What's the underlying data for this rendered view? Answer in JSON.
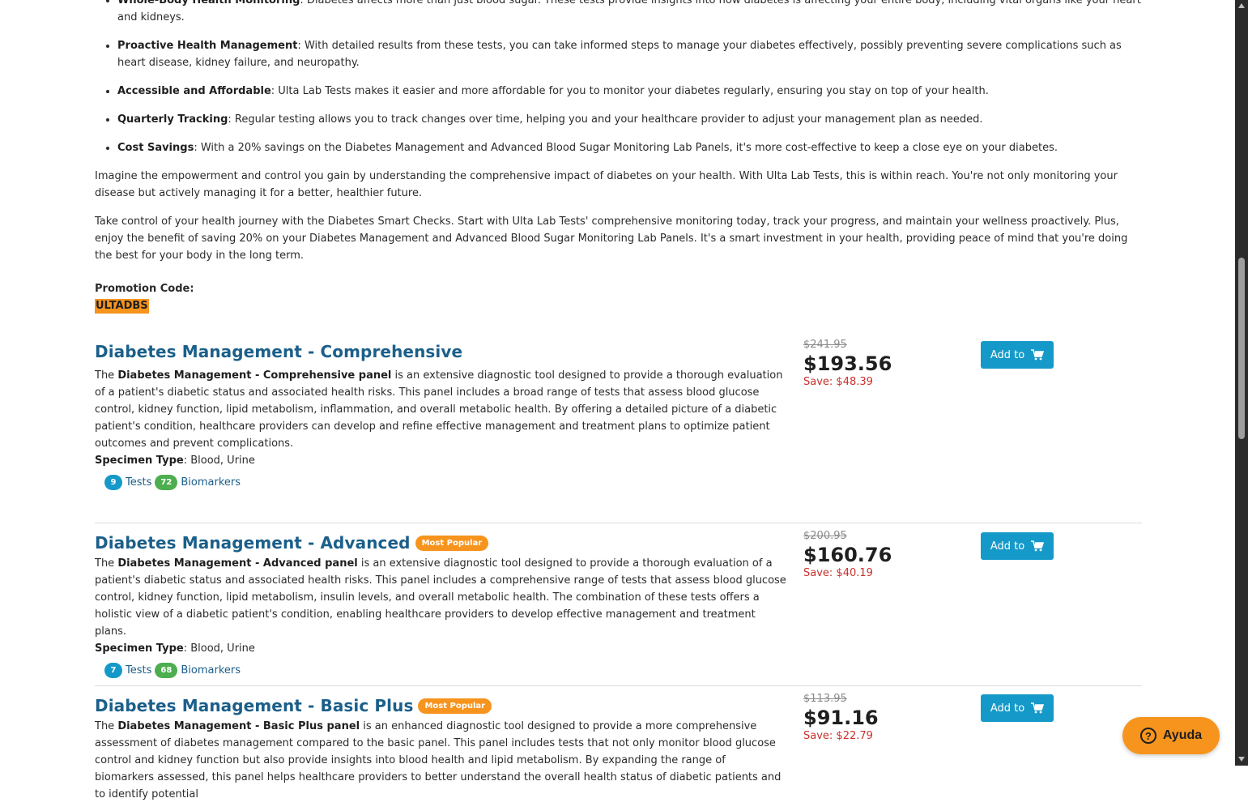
{
  "benefits": [
    {
      "title": "Whole-Body Health Monitoring",
      "text": ": Diabetes affects more than just blood sugar. These tests provide insights into how diabetes is affecting your entire body, including vital organs like your heart and kidneys."
    },
    {
      "title": "Proactive Health Management",
      "text": ": With detailed results from these tests, you can take informed steps to manage your diabetes effectively, possibly preventing severe complications such as heart disease, kidney failure, and neuropathy."
    },
    {
      "title": "Accessible and Affordable",
      "text": ": Ulta Lab Tests makes it easier and more affordable for you to monitor your diabetes regularly, ensuring you stay on top of your health."
    },
    {
      "title": "Quarterly Tracking",
      "text": ": Regular testing allows you to track changes over time, helping you and your healthcare provider to adjust your management plan as needed."
    },
    {
      "title": "Cost Savings",
      "text": ": With a 20% savings on the Diabetes Management and Advanced Blood Sugar Monitoring Lab Panels, it's more cost-effective to keep a close eye on your diabetes."
    }
  ],
  "paragraphs": [
    "Imagine the empowerment and control you gain by understanding the comprehensive impact of diabetes on your health. With Ulta Lab Tests, this is within reach. You're not only monitoring your disease but actively managing it for a better, healthier future.",
    "Take control of your health journey with the Diabetes Smart Checks. Start with Ulta Lab Tests' comprehensive monitoring today, track your progress, and maintain your wellness proactively. Plus, enjoy the benefit of saving 20% on your Diabetes Management and Advanced Blood Sugar Monitoring Lab Panels. It's a smart investment in your health, providing peace of mind that you're doing the best for your body in the long term."
  ],
  "promo": {
    "label": "Promotion Code:",
    "code": "ULTADBS"
  },
  "products": [
    {
      "title": "Diabetes Management - Comprehensive",
      "badge": "",
      "desc_prefix": " The ",
      "desc_bold": "Diabetes Management - Comprehensive panel",
      "desc_rest": " is an extensive diagnostic tool designed to provide a thorough evaluation of a patient's diabetic status and associated health risks. This panel includes a broad range of tests that assess blood glucose control, kidney function, lipid metabolism, inflammation, and overall metabolic health. By offering a detailed picture of a diabetic patient's condition, healthcare providers can develop and refine effective management and treatment plans to optimize patient outcomes and prevent complications.",
      "specimen_label": "Specimen Type",
      "specimen_value": ": Blood, Urine",
      "tests_count": "9",
      "tests_label": "Tests",
      "biomarkers_count": "72",
      "biomarkers_label": "Biomarkers",
      "old_price": "$241.95",
      "price": "$193.56",
      "save": "Save: $48.39",
      "add_label": "Add to"
    },
    {
      "title": "Diabetes Management - Advanced",
      "badge": "Most Popular",
      "desc_prefix": " The ",
      "desc_bold": "Diabetes Management - Advanced panel",
      "desc_rest": " is an extensive diagnostic tool designed to provide a thorough evaluation of a patient's diabetic status and associated health risks. This panel includes a comprehensive range of tests that assess blood glucose control, kidney function, lipid metabolism, insulin levels, and overall metabolic health. The combination of these tests offers a holistic view of a diabetic patient's condition, enabling healthcare providers to develop effective management and treatment plans.",
      "specimen_label": "Specimen Type",
      "specimen_value": ": Blood, Urine",
      "tests_count": "7",
      "tests_label": "Tests",
      "biomarkers_count": "68",
      "biomarkers_label": "Biomarkers",
      "old_price": "$200.95",
      "price": "$160.76",
      "save": "Save: $40.19",
      "add_label": "Add to"
    },
    {
      "title": "Diabetes Management - Basic Plus",
      "badge": "Most Popular",
      "desc_prefix": " The ",
      "desc_bold": "Diabetes Management - Basic Plus panel",
      "desc_rest": " is an enhanced diagnostic tool designed to provide a more comprehensive assessment of diabetes management compared to the basic panel. This panel includes tests that not only monitor blood glucose control and kidney function but also provide insights into blood health and lipid metabolism. By expanding the range of biomarkers assessed, this panel helps healthcare providers to better understand the overall health status of diabetic patients and to identify potential",
      "old_price": "$113.95",
      "price": "$91.16",
      "save": "Save: $22.79",
      "add_label": "Add to"
    }
  ],
  "help": {
    "label": "Ayuda"
  },
  "colors": {
    "accent": "#1599c9",
    "title": "#1b5f8a",
    "orange": "#f7941d",
    "green": "#4cae4f",
    "save_red": "#c9302c"
  }
}
